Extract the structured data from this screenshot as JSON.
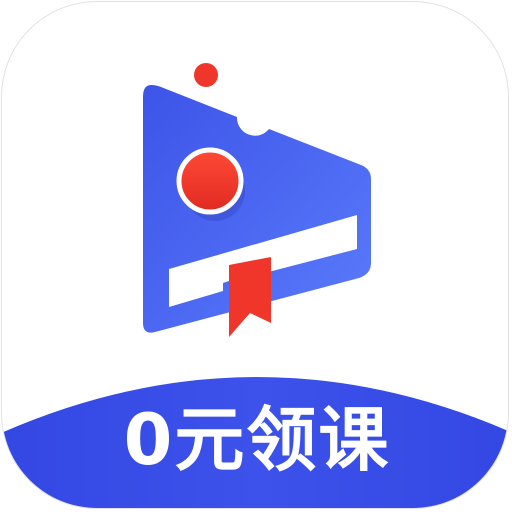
{
  "app_icon": {
    "banner_text": "0元领课",
    "colors": {
      "play_blue": "#4a66f2",
      "banner_blue": "#3a4ee6",
      "accent_red": "#f0362a",
      "white": "#ffffff"
    },
    "logo_icon": "play-ticket-logo-icon"
  }
}
